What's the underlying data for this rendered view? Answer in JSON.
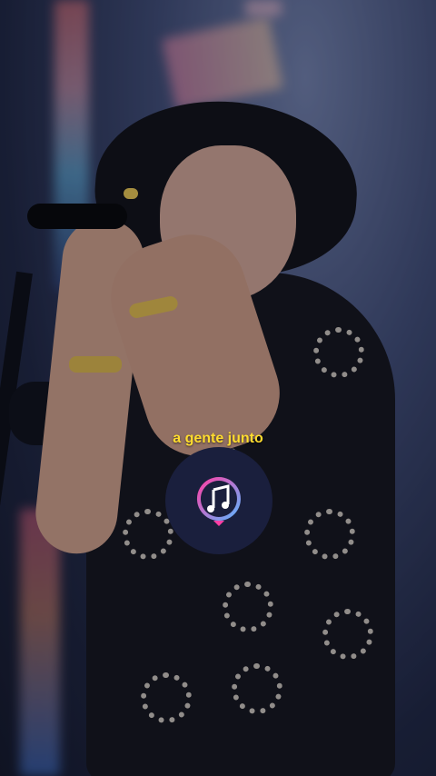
{
  "lyric": {
    "text": "a gente junto"
  },
  "music_button": {
    "icon": "music-note-icon",
    "accent_colors": [
      "#ff3fa6",
      "#5fb4ff"
    ],
    "background": "#1a1f3d"
  }
}
